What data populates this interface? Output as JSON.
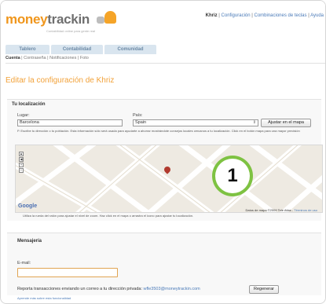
{
  "app": {
    "logo_money": "money",
    "logo_trackin": "trackin",
    "tagline": "Contabilidad online para gente real"
  },
  "toplinks": {
    "user": "Khriz",
    "config": "Configuración",
    "shortcuts": "Combinaciones de teclas",
    "help": "Ayuda"
  },
  "tabs": [
    {
      "label": "Tablero"
    },
    {
      "label": "Contabilidad"
    },
    {
      "label": "Comunidad"
    }
  ],
  "subnav": {
    "account": "Cuenta",
    "password": "Contraseña",
    "notifications": "Notificaciones",
    "photo": "Foto"
  },
  "page_title": "Editar la configuración de Khriz",
  "location": {
    "title": "Tu localización",
    "place_label": "Lugar:",
    "place_value": "Barcelona",
    "country_label": "País:",
    "country_value": "Spain",
    "map_button": "Ajustar en el mapa",
    "hint": "P. Escribe tu dirección o tu población. Esta información sólo será usada para ayudarte a ahorrar mostrándote consejos locales cercanos a tu localización. Click en el botón mapa para una mayor precisión",
    "map_hint": "Utiliza la rueda del ratón para ajustar el nivel de zoom. Haz click en el mapa o arrastra el icono para ajustar tu localización.",
    "map_credit": "Datos de mapa ©2009 Tele Atlas -",
    "map_terms": "Términos de uso",
    "map_brand": "Google",
    "callout": "1"
  },
  "messaging": {
    "title": "Mensajería",
    "email_label": "E-mail:",
    "email_value": "",
    "report_text": "Reporta transacciones enviando un correo a tu dirección privada:",
    "report_email": "wfle3503@moneytrackin.com",
    "regen_button": "Regenerar",
    "learn_more": "Aprende más sobre esta funcionalidad"
  },
  "colors": {
    "accent": "#f2a23a",
    "tab_bg": "#d9e5ef",
    "link": "#4a7ab8",
    "callout_ring": "#7ec242"
  }
}
